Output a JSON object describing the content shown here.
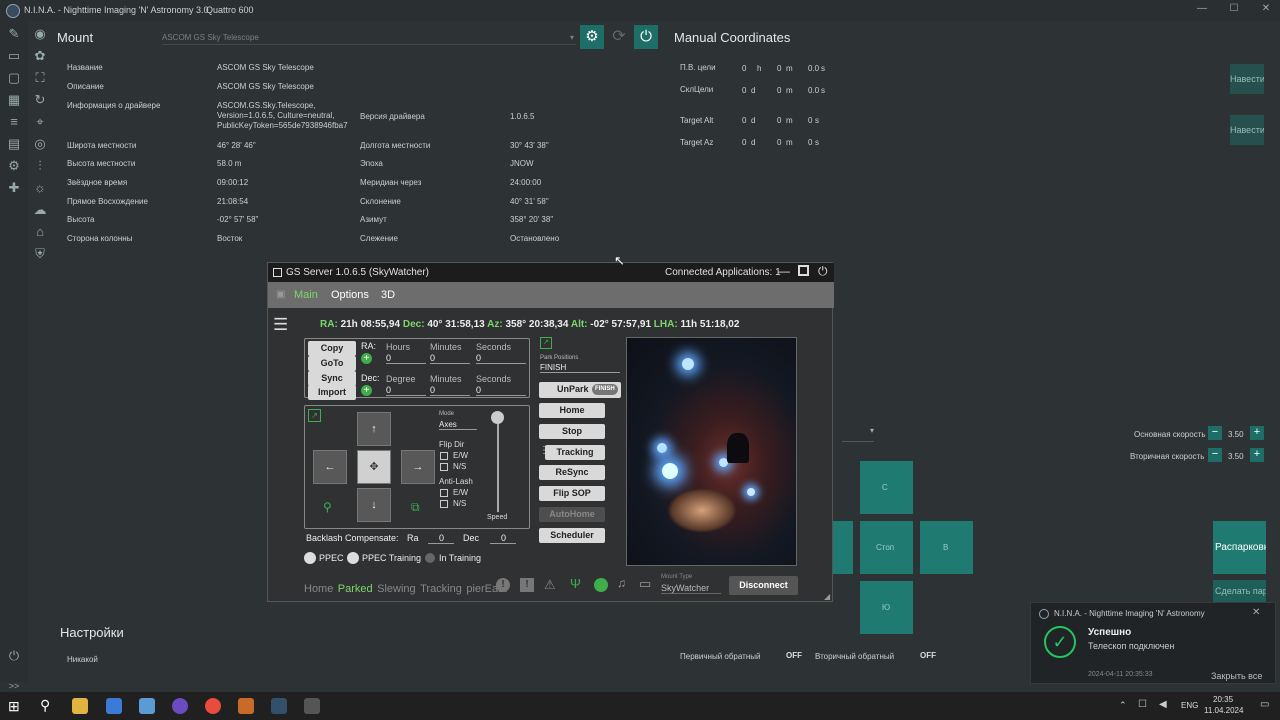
{
  "window": {
    "app_title": "N.I.N.A. - Nighttime Imaging 'N' Astronomy 3.0",
    "profile": "Quattro 600"
  },
  "mount": {
    "header": "Mount",
    "selected_device": "ASCOM GS Sky Telescope",
    "left_rows": [
      {
        "label": "Название",
        "value": "ASCOM GS Sky Telescope"
      },
      {
        "label": "Описание",
        "value": "ASCOM GS Sky Telescope"
      },
      {
        "label": "Информация о драйвере",
        "value": "ASCOM.GS.Sky.Telescope, Version=1.0.6.5, Culture=neutral, PublicKeyToken=565de7938946fba7"
      },
      {
        "label": "Широта местности",
        "value": "46° 28' 46\""
      },
      {
        "label": "Высота местности",
        "value": "58.0 m"
      },
      {
        "label": "Звёздное время",
        "value": "09:00:12"
      },
      {
        "label": "Прямое Восхождение",
        "value": "21:08:54"
      },
      {
        "label": "Высота",
        "value": "-02° 57' 58\""
      },
      {
        "label": "Сторона колонны",
        "value": "Восток"
      }
    ],
    "right_rows": [
      {
        "label": "Версия драйвера",
        "value": "1.0.6.5"
      },
      {
        "label": "Долгота местности",
        "value": "30° 43' 38\""
      },
      {
        "label": "Эпоха",
        "value": "JNOW"
      },
      {
        "label": "Меридиан через",
        "value": "24:00:00"
      },
      {
        "label": "Склонение",
        "value": "40° 31' 58\""
      },
      {
        "label": "Азимут",
        "value": "358° 20' 38\""
      },
      {
        "label": "Слежение",
        "value": "Остановлено"
      }
    ]
  },
  "manual_coordinates": {
    "header": "Manual Coordinates",
    "rows": [
      {
        "label": "П.В. цели",
        "v1": "0",
        "u1": "h",
        "v2": "0",
        "u2": "m",
        "v3": "0.0",
        "u3": "s"
      },
      {
        "label": "СклЦели",
        "v1": "0",
        "u1": "d",
        "v2": "0",
        "u2": "m",
        "v3": "0.0",
        "u3": "s"
      },
      {
        "label": "Target Alt",
        "v1": "0",
        "u1": "d",
        "v2": "0",
        "u2": "m",
        "v3": "0",
        "u3": "s"
      },
      {
        "label": "Target Az",
        "v1": "0",
        "u1": "d",
        "v2": "0",
        "u2": "m",
        "v3": "0",
        "u3": "s"
      }
    ],
    "slew_button_1": "Навести",
    "slew_button_2": "Навести"
  },
  "speeds": {
    "primary_label": "Основная скорость",
    "primary_value": "3.50",
    "secondary_label": "Вторичная скорость",
    "secondary_value": "3.50"
  },
  "direction_pad": {
    "north": "С",
    "stop": "Стоп",
    "east": "В",
    "south": "Ю"
  },
  "park": {
    "unpark_button": "Распарковк",
    "set_park_button": "Сделать пар"
  },
  "settings": {
    "header": "Настройки",
    "guider_label": "Никакой",
    "primary_reverse_label": "Первичный обратный",
    "primary_reverse_value": "OFF",
    "secondary_reverse_label": "Вторичный обратный",
    "secondary_reverse_value": "OFF"
  },
  "gs": {
    "title": "GS Server 1.0.6.5 (SkyWatcher)",
    "connected": "Connected Applications: 1",
    "menu": [
      "Main",
      "Options",
      "3D"
    ],
    "ra_label": "RA:",
    "ra_value": "21h 08:55,94",
    "dec_label": "Dec:",
    "dec_value": "40° 31:58,13",
    "az_label": "Az:",
    "az_value": "358° 20:38,34",
    "alt_label": "Alt:",
    "alt_value": "-02° 57:57,91",
    "lha_label": "LHA:",
    "lha_value": "11h 51:18,02",
    "goto_buttons": [
      "Copy",
      "GoTo",
      "Sync",
      "Import"
    ],
    "ra_input_label": "RA:",
    "dec_input_label": "Dec:",
    "ra_fields": [
      {
        "label": "Hours",
        "value": "0"
      },
      {
        "label": "Minutes",
        "value": "0"
      },
      {
        "label": "Seconds",
        "value": "0"
      }
    ],
    "dec_fields": [
      {
        "label": "Degree",
        "value": "0"
      },
      {
        "label": "Minutes",
        "value": "0"
      },
      {
        "label": "Seconds",
        "value": "0"
      }
    ],
    "mode_label": "Mode",
    "mode_value": "Axes",
    "flip_dir_label": "Flip Dir",
    "anti_lash_label": "Anti-Lash",
    "ew_label": "E/W",
    "ns_label": "N/S",
    "speed_label": "Speed",
    "backlash_label": "Backlash Compensate:",
    "backlash_ra_label": "Ra",
    "backlash_ra_value": "0",
    "backlash_dec_label": "Dec",
    "backlash_dec_value": "0",
    "ppec_label": "PPEC",
    "ppec_training_label": "PPEC Training",
    "in_training_label": "In Training",
    "park_positions_label": "Park Positions",
    "park_positions_value": "FINISH",
    "unpark_label": "UnPark",
    "unpark_badge": "FINISH",
    "action_buttons": [
      "Home",
      "Stop",
      "Tracking",
      "ReSync",
      "Flip SOP",
      "AutoHome",
      "Scheduler"
    ],
    "status_items": [
      "Home",
      "Parked",
      "Slewing",
      "Tracking",
      "pierEast"
    ],
    "mount_type_label": "Mount Type",
    "mount_type_value": "SkyWatcher",
    "disconnect": "Disconnect"
  },
  "toast": {
    "app": "N.I.N.A. - Nighttime Imaging 'N' Astronomy",
    "title": "Успешно",
    "message": "Телескоп подключен",
    "timestamp": "2024-04-11 20:35:33",
    "close_all": "Закрыть все"
  },
  "taskbar": {
    "language": "ENG",
    "time": "20:35",
    "date": "11.04.2024"
  },
  "colors": {
    "accent_teal": "#1e6e68",
    "success_green": "#22c55e",
    "gs_label_green": "#7dd66b"
  }
}
